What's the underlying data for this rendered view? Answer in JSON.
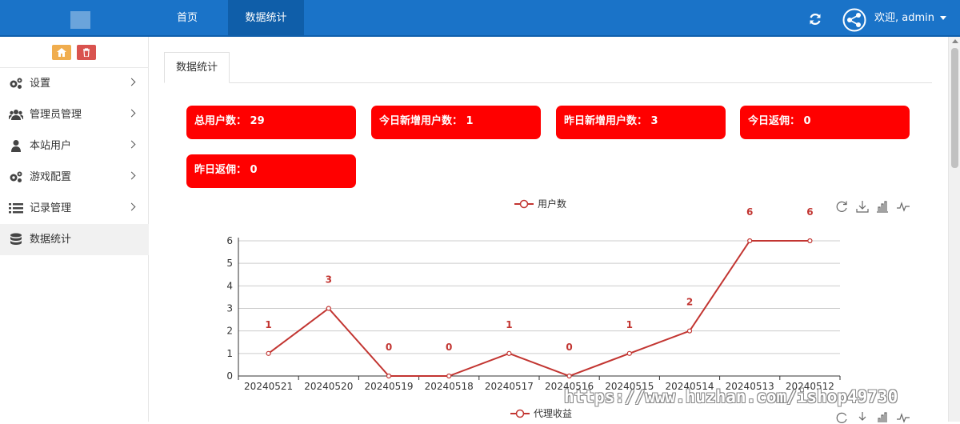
{
  "header": {
    "nav": [
      "首页",
      "数据统计"
    ],
    "welcome": "欢迎, admin"
  },
  "sidebar": {
    "items": [
      {
        "label": "设置",
        "icon": "gears-icon"
      },
      {
        "label": "管理员管理",
        "icon": "users-icon"
      },
      {
        "label": "本站用户",
        "icon": "user-icon"
      },
      {
        "label": "游戏配置",
        "icon": "gears-icon"
      },
      {
        "label": "记录管理",
        "icon": "list-icon"
      },
      {
        "label": "数据统计",
        "icon": "database-icon"
      }
    ]
  },
  "tab": {
    "label": "数据统计"
  },
  "stats": [
    "总用户数： 29",
    "今日新增用户数： 1",
    "昨日新增用户数： 3",
    "今日返佣： 0",
    "昨日返佣： 0"
  ],
  "colors": {
    "header": "#1a73c8",
    "stat_card": "#ff0000",
    "series": "#c23531"
  },
  "chart_data": [
    {
      "type": "line",
      "legend": "用户数",
      "categories": [
        "20240521",
        "20240520",
        "20240519",
        "20240518",
        "20240517",
        "20240516",
        "20240515",
        "20240514",
        "20240513",
        "20240512"
      ],
      "series": [
        {
          "name": "用户数",
          "values": [
            1,
            3,
            0,
            0,
            1,
            0,
            1,
            2,
            6,
            6
          ]
        }
      ],
      "ylim": [
        0,
        6
      ],
      "yticks": [
        "0",
        "1",
        "2",
        "3",
        "4",
        "5",
        "6"
      ],
      "grid": true,
      "legend_position": "top-center"
    },
    {
      "type": "line",
      "legend": "代理收益",
      "series": [
        {
          "name": "代理收益",
          "values": []
        }
      ]
    }
  ],
  "watermark": "https://www.huzhan.com/ishop49730"
}
